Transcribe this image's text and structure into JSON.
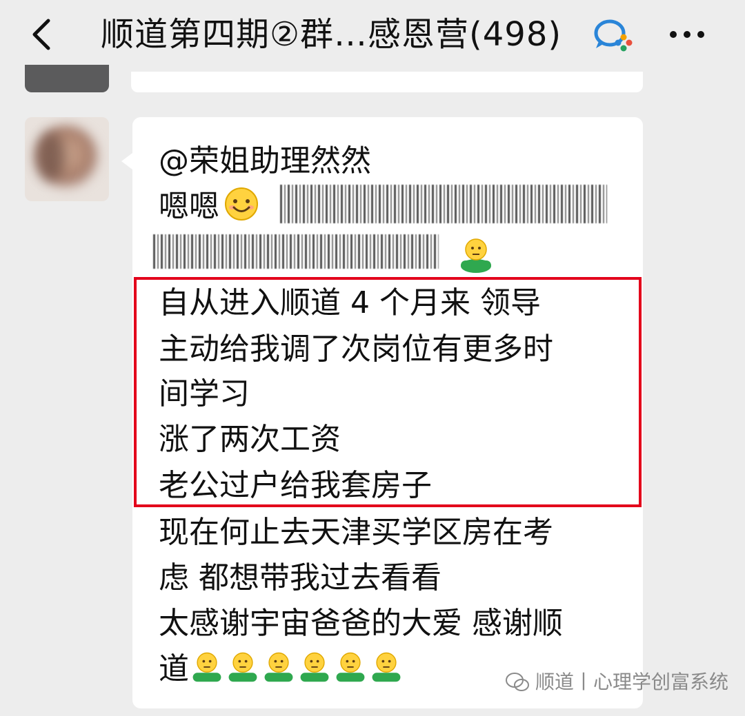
{
  "header": {
    "title": "顺道第四期②群…感恩营(498)",
    "back_icon": "chevron-left-icon",
    "chat_icon": "wecom-chat-icon",
    "more_icon": "more-dots-icon"
  },
  "message": {
    "lines": [
      "@荣姐助理然然",
      "嗯嗯",
      "自从进入顺道 4 个月来 领导",
      "主动给我调了次岗位有更多时",
      "间学习",
      "涨了两次工资",
      "老公过户给我套房子",
      "现在何止去天津买学区房在考",
      "虑 都想带我过去看看",
      "太感谢宇宙爸爸的大爱 感谢顺",
      "道"
    ]
  },
  "watermark": {
    "text": "顺道丨心理学创富系统"
  },
  "colors": {
    "background": "#ededed",
    "bubble": "#ffffff",
    "highlight": "#e3001b",
    "watermark": "#8a8a8a"
  }
}
